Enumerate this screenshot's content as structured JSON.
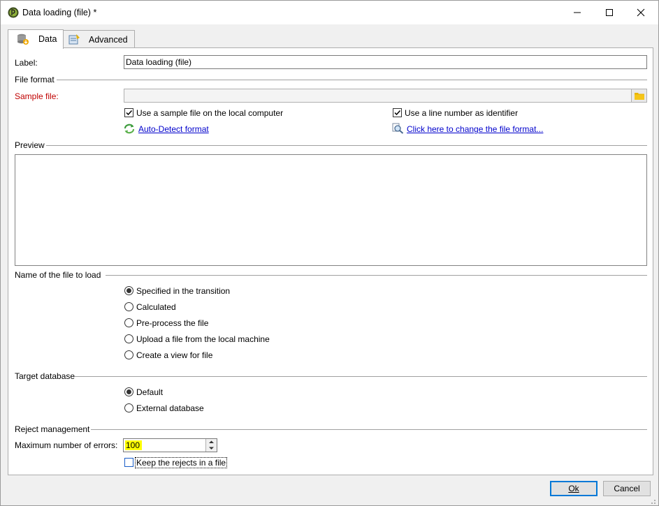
{
  "window": {
    "title": "Data loading (file) *",
    "controls": [
      "minimize",
      "maximize",
      "close"
    ]
  },
  "tabs": [
    {
      "label": "Data",
      "icon": "data-tab-icon",
      "active": true
    },
    {
      "label": "Advanced",
      "icon": "advanced-tab-icon",
      "active": false
    }
  ],
  "form": {
    "label_caption": "Label:",
    "label_value": "Data loading (file)",
    "file_format_section": "File format",
    "sample_file_caption": "Sample file:",
    "sample_file_value": "",
    "use_sample_local": {
      "label": "Use a sample file on the local computer",
      "checked": true
    },
    "use_line_number": {
      "label": "Use a line number as identifier",
      "checked": true
    },
    "auto_detect_link": "Auto-Detect format",
    "change_format_link": "Click here to change the file format...",
    "preview_section": "Preview",
    "file_to_load_section": "Name of the file to load",
    "file_options": [
      {
        "label": "Specified in the transition",
        "selected": true
      },
      {
        "label": "Calculated",
        "selected": false
      },
      {
        "label": "Pre-process the file",
        "selected": false
      },
      {
        "label": "Upload a file from the local machine",
        "selected": false
      },
      {
        "label": "Create a view for file",
        "selected": false
      }
    ],
    "target_db_section": "Target database",
    "db_options": [
      {
        "label": "Default",
        "selected": true
      },
      {
        "label": "External database",
        "selected": false
      }
    ],
    "reject_section": "Reject management",
    "max_errors_caption": "Maximum number of errors:",
    "max_errors_value": "100",
    "keep_rejects": {
      "label": "Keep the rejects in a file",
      "checked": false
    }
  },
  "buttons": {
    "ok": "Ok",
    "cancel": "Cancel"
  },
  "colors": {
    "required_label": "#c00000",
    "link": "#0000cc",
    "highlight": "#ffff00",
    "default_button_border": "#0078d7"
  }
}
